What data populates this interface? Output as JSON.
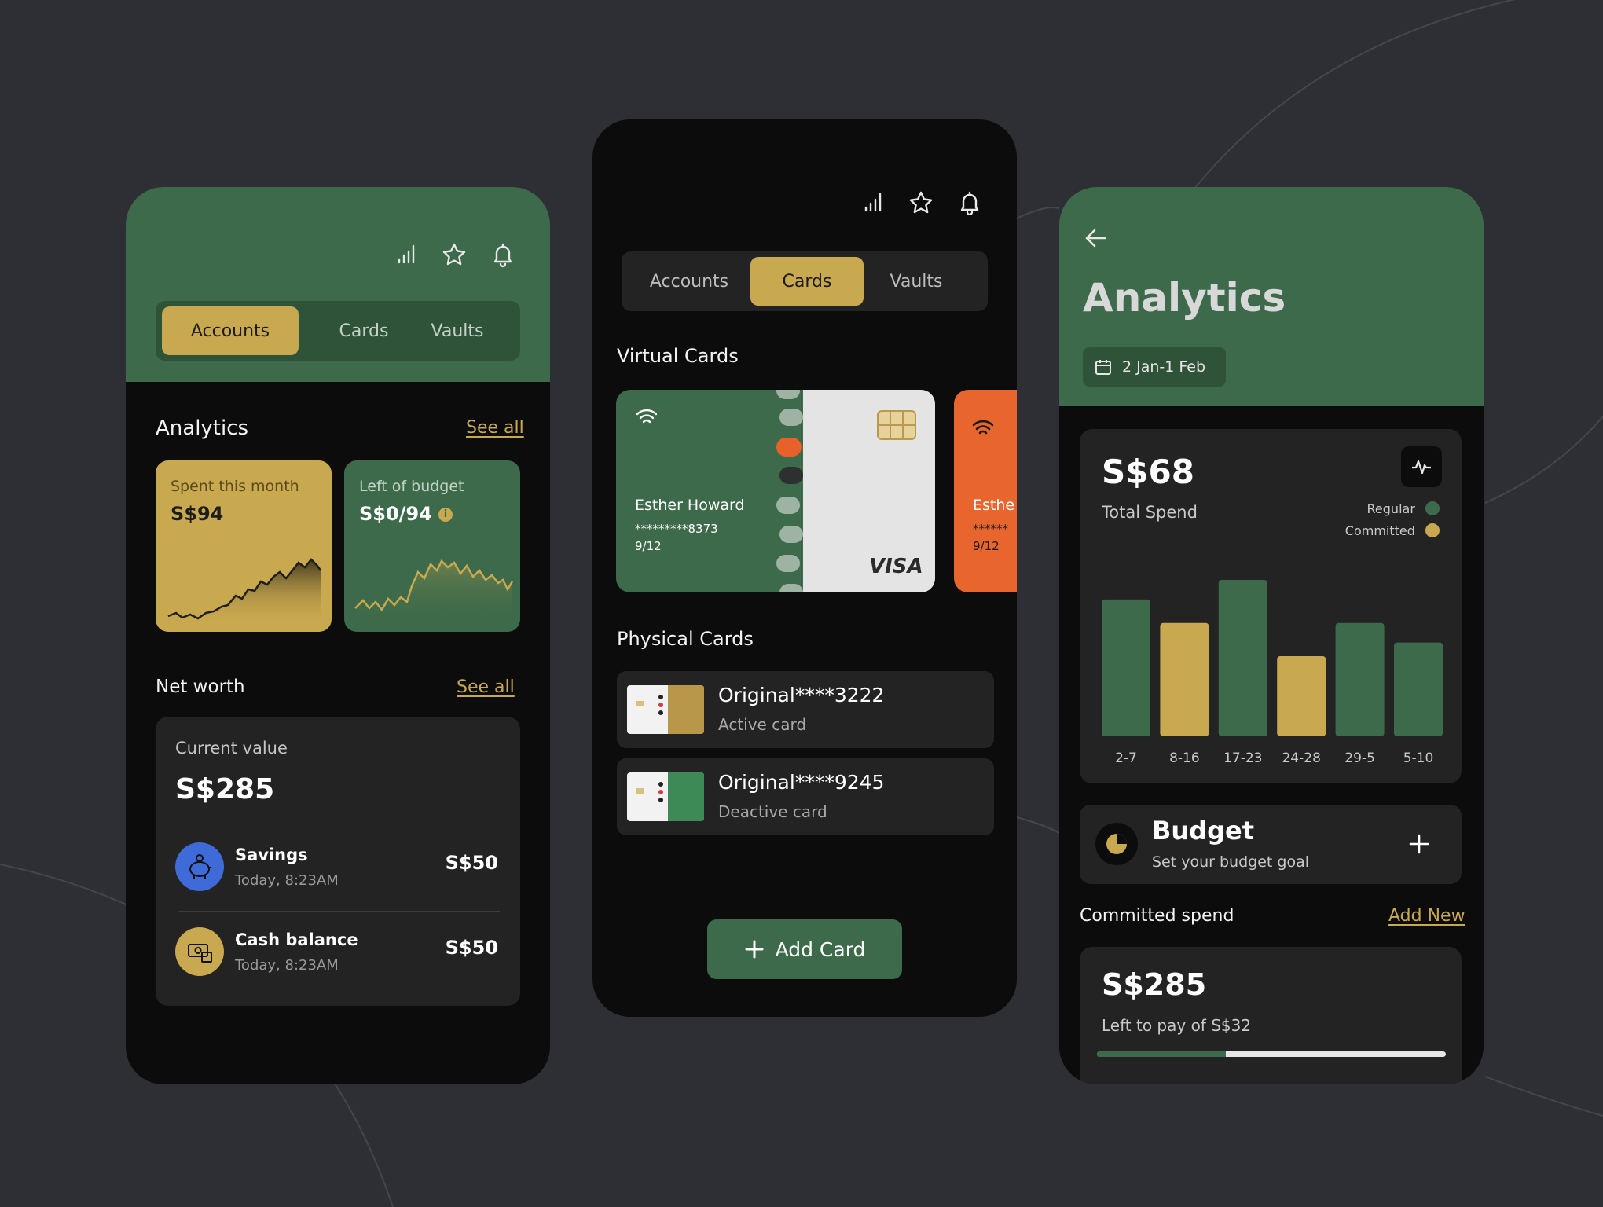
{
  "colors": {
    "bg": "#2e2f34",
    "green": "#3d6a4a",
    "gold": "#c9a94f",
    "dark": "#0c0c0d",
    "panel": "#232324",
    "orange": "#e86a2e"
  },
  "screen1": {
    "tabs": [
      "Accounts",
      "Cards",
      "Vaults"
    ],
    "active_tab": "Accounts",
    "analytics_title": "Analytics",
    "see_all": "See all",
    "spent_label": "Spent this month",
    "spent_value": "S$94",
    "left_label": "Left of budget",
    "left_value": "S$0/94",
    "networth_title": "Net worth",
    "current_value_label": "Current value",
    "current_value": "S$285",
    "items": [
      {
        "name": "Savings",
        "time": "Today, 8:23AM",
        "amount": "S$50",
        "icon": "piggy-bank-icon"
      },
      {
        "name": "Cash balance",
        "time": "Today, 8:23AM",
        "amount": "S$50",
        "icon": "cash-icon"
      }
    ]
  },
  "screen2": {
    "tabs": [
      "Accounts",
      "Cards",
      "Vaults"
    ],
    "active_tab": "Cards",
    "virtual_title": "Virtual Cards",
    "card_holder": "Esther Howard",
    "card_number": "*********8373",
    "card_expiry": "9/12",
    "card_brand": "VISA",
    "card2_holder": "Esthe",
    "card2_number": "******",
    "card2_expiry": "9/12",
    "physical_title": "Physical Cards",
    "physical": [
      {
        "name": "Original****3222",
        "status": "Active card"
      },
      {
        "name": "Original****9245",
        "status": "Deactive card"
      }
    ],
    "add_card": "Add Card"
  },
  "screen3": {
    "title": "Analytics",
    "date_range": "2 Jan-1 Feb",
    "total_value": "S$68",
    "total_label": "Total Spend",
    "legend": [
      "Regular",
      "Committed"
    ],
    "budget_title": "Budget",
    "budget_sub": "Set your budget goal",
    "committed_title": "Committed spend",
    "add_new": "Add New",
    "committed_value": "S$285",
    "committed_sub": "Left to pay of S$32",
    "progress": 0.37
  },
  "chart_data": {
    "type": "bar",
    "categories": [
      "2-7",
      "8-16",
      "17-23",
      "24-28",
      "29-5",
      "5-10"
    ],
    "series": [
      {
        "name": "Regular",
        "values": [
          70,
          null,
          80,
          null,
          58,
          48
        ]
      },
      {
        "name": "Committed",
        "values": [
          null,
          58,
          null,
          41,
          null,
          null
        ]
      }
    ],
    "colors": [
      "#3d6a4a",
      "#c9a94f",
      "#3d6a4a",
      "#c9a94f",
      "#3d6a4a",
      "#3d6a4a"
    ],
    "ylim": [
      0,
      80
    ],
    "grid": false,
    "legend": "top-right"
  }
}
